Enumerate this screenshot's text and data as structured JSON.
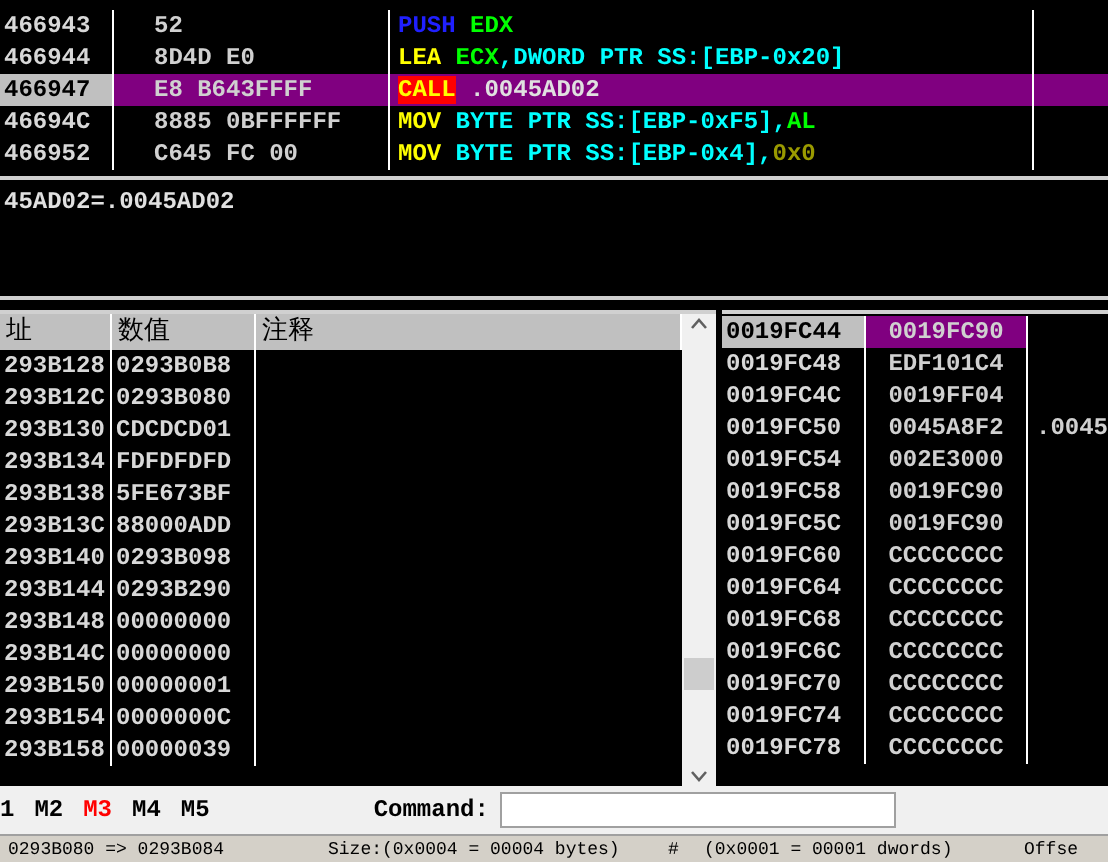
{
  "disassembly": {
    "rows": [
      {
        "address": "466943",
        "hex": "52",
        "selected": false,
        "instruction": [
          {
            "text": "PUSH",
            "kind": "push"
          },
          {
            "text": " EDX",
            "kind": "reg"
          }
        ]
      },
      {
        "address": "466944",
        "hex": "8D4D E0",
        "selected": false,
        "instruction": [
          {
            "text": "LEA",
            "kind": "mnemonic"
          },
          {
            "text": " ECX",
            "kind": "reg"
          },
          {
            "text": ",DWORD PTR SS:[EBP-0x20]",
            "kind": "mem"
          }
        ]
      },
      {
        "address": "466947",
        "hex": "E8 B643FFFF",
        "selected": true,
        "instruction": [
          {
            "text": "CALL",
            "kind": "call"
          },
          {
            "text": " .0045AD02",
            "kind": "target"
          }
        ]
      },
      {
        "address": "46694C",
        "hex": "8885 0BFFFFFF",
        "selected": false,
        "instruction": [
          {
            "text": "MOV",
            "kind": "mnemonic"
          },
          {
            "text": " BYTE PTR SS:[EBP-0xF5],",
            "kind": "mem"
          },
          {
            "text": "AL",
            "kind": "reg"
          }
        ]
      },
      {
        "address": "466952",
        "hex": "C645 FC 00",
        "selected": false,
        "instruction": [
          {
            "text": "MOV",
            "kind": "mnemonic"
          },
          {
            "text": " BYTE PTR SS:[EBP-0x4],",
            "kind": "mem"
          },
          {
            "text": "0x0",
            "kind": "imm"
          }
        ]
      }
    ]
  },
  "info": "45AD02=.0045AD02",
  "dump": {
    "columns": [
      "址",
      "数值",
      "注释"
    ],
    "rows": [
      {
        "address": "293B128",
        "value": "0293B0B8"
      },
      {
        "address": "293B12C",
        "value": "0293B080"
      },
      {
        "address": "293B130",
        "value": "CDCDCD01"
      },
      {
        "address": "293B134",
        "value": "FDFDFDFD"
      },
      {
        "address": "293B138",
        "value": "5FE673BF"
      },
      {
        "address": "293B13C",
        "value": "88000ADD"
      },
      {
        "address": "293B140",
        "value": "0293B098"
      },
      {
        "address": "293B144",
        "value": "0293B290"
      },
      {
        "address": "293B148",
        "value": "00000000"
      },
      {
        "address": "293B14C",
        "value": "00000000"
      },
      {
        "address": "293B150",
        "value": "00000001"
      },
      {
        "address": "293B154",
        "value": "0000000C"
      },
      {
        "address": "293B158",
        "value": "00000039"
      }
    ]
  },
  "stack": {
    "rows": [
      {
        "address": "0019FC44",
        "value": "0019FC90",
        "selected": true
      },
      {
        "address": "0019FC48",
        "value": "EDF101C4",
        "selected": false
      },
      {
        "address": "0019FC4C",
        "value": "0019FF04",
        "selected": false
      },
      {
        "address": "0019FC50",
        "value": "0045A8F2",
        "comment": ".0045",
        "selected": false
      },
      {
        "address": "0019FC54",
        "value": "002E3000",
        "selected": false
      },
      {
        "address": "0019FC58",
        "value": "0019FC90",
        "selected": false
      },
      {
        "address": "0019FC5C",
        "value": "0019FC90",
        "selected": false
      },
      {
        "address": "0019FC60",
        "value": "CCCCCCCC",
        "selected": false
      },
      {
        "address": "0019FC64",
        "value": "CCCCCCCC",
        "selected": false
      },
      {
        "address": "0019FC68",
        "value": "CCCCCCCC",
        "selected": false
      },
      {
        "address": "0019FC6C",
        "value": "CCCCCCCC",
        "selected": false
      },
      {
        "address": "0019FC70",
        "value": "CCCCCCCC",
        "selected": false
      },
      {
        "address": "0019FC74",
        "value": "CCCCCCCC",
        "selected": false
      },
      {
        "address": "0019FC78",
        "value": "CCCCCCCC",
        "selected": false
      }
    ]
  },
  "memory_tabs": [
    {
      "label": "1",
      "selected": false
    },
    {
      "label": "M2",
      "selected": false
    },
    {
      "label": "M3",
      "selected": true
    },
    {
      "label": "M4",
      "selected": false
    },
    {
      "label": "M5",
      "selected": false
    }
  ],
  "command": {
    "label": "Command:"
  },
  "status_bar": [
    "0293B080 => 0293B084",
    "Size:(0x0004 = 00004 bytes)",
    "#",
    "(0x0001 = 00001 dwords)",
    "Offse"
  ]
}
